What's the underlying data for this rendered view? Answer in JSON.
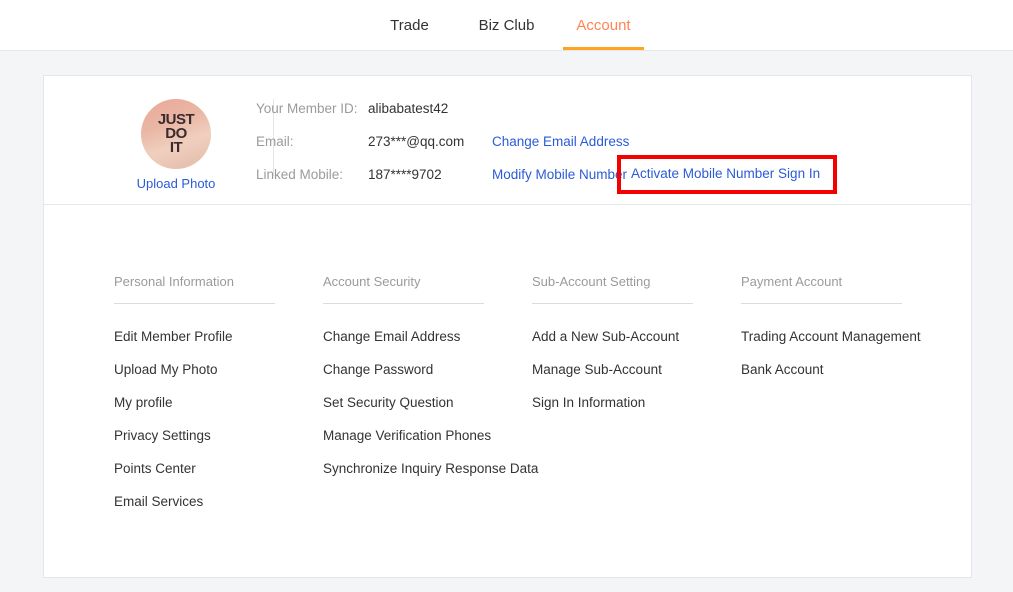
{
  "nav": {
    "tabs": [
      {
        "label": "Trade",
        "active": false
      },
      {
        "label": "Biz Club",
        "active": false
      },
      {
        "label": "Account",
        "active": true
      }
    ],
    "active_color": "#ff8552",
    "underline_color": "#ffa320"
  },
  "profile": {
    "avatar": {
      "alt": "JUST DO IT",
      "line1": "JUST",
      "line2": "DO",
      "line3": "IT"
    },
    "upload_photo_label": "Upload Photo",
    "rows": [
      {
        "label": "Your Member ID:",
        "value": "alibabatest42",
        "links": []
      },
      {
        "label": "Email:",
        "value": "273***@qq.com",
        "links": [
          "Change Email Address"
        ]
      },
      {
        "label": "Linked Mobile:",
        "value": "187****9702",
        "links": [
          "Modify Mobile Number"
        ]
      }
    ],
    "activate_link_label": "Activate Mobile Number Sign In"
  },
  "annotation": {
    "color": "#f50000",
    "target": "Activate Mobile Number Sign In"
  },
  "columns": [
    {
      "title": "Personal Information",
      "links": [
        "Edit Member Profile",
        "Upload My Photo",
        "My profile",
        "Privacy Settings",
        "Points Center",
        "Email Services"
      ]
    },
    {
      "title": "Account Security",
      "links": [
        "Change Email Address",
        "Change Password",
        "Set Security Question",
        "Manage Verification Phones",
        "Synchronize Inquiry Response Data"
      ]
    },
    {
      "title": "Sub-Account Setting",
      "links": [
        "Add a New Sub-Account",
        "Manage Sub-Account",
        "Sign In Information"
      ]
    },
    {
      "title": "Payment Account",
      "links": [
        "Trading Account Management",
        "Bank Account"
      ]
    }
  ]
}
